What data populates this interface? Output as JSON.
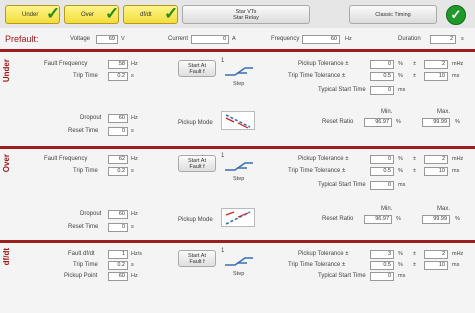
{
  "tabs": {
    "under": "Under",
    "over": "Over",
    "dfdt": "df/dt",
    "starvts": "Star VTs\nStar Relay",
    "classic": "Classic Timing"
  },
  "prefault": {
    "title": "Prefault:",
    "voltage_label": "Voltage",
    "voltage": "69",
    "voltage_unit": "V",
    "current_label": "Current",
    "current": "0",
    "current_unit": "A",
    "frequency_label": "Frequency",
    "frequency": "60",
    "frequency_unit": "Hz",
    "duration_label": "Duration",
    "duration": "2",
    "duration_unit": "s"
  },
  "under": {
    "title": "Under",
    "fault_freq_label": "Fault Frequency",
    "fault_freq": "58",
    "fault_freq_unit": "Hz",
    "trip_time_label": "Trip Time",
    "trip_time": "0.2",
    "trip_time_unit": "s",
    "dropout_label": "Dropout",
    "dropout": "60",
    "dropout_unit": "Hz",
    "reset_time_label": "Reset Time",
    "reset_time": "0",
    "reset_time_unit": "s",
    "start_btn": "Start At\nFault f",
    "ladder_label": "1",
    "ladder_step": "Step",
    "pickup_mode_label": "Pickup Mode",
    "pickup_tol_label": "Pickup Tolerance ±",
    "pickup_tol_pct": "0",
    "pickup_tol_abs": "2",
    "pickup_tol_abs_unit": "mHz",
    "trip_tol_label": "Trip Time Tolerance ±",
    "trip_tol_pct": "0.5",
    "trip_tol_abs": "10",
    "trip_tol_abs_unit": "ms",
    "typ_start_label": "Typical Start Time",
    "typ_start": "0",
    "typ_start_unit": "ms",
    "min_label": "Min.",
    "max_label": "Max.",
    "reset_ratio_label": "Reset Ratio",
    "reset_min": "96.97",
    "reset_max": "99.99"
  },
  "over": {
    "title": "Over",
    "fault_freq_label": "Fault Frequency",
    "fault_freq": "62",
    "fault_freq_unit": "Hz",
    "trip_time_label": "Trip Time",
    "trip_time": "0.2",
    "trip_time_unit": "s",
    "dropout_label": "Dropout",
    "dropout": "60",
    "dropout_unit": "Hz",
    "reset_time_label": "Reset Time",
    "reset_time": "0",
    "reset_time_unit": "s",
    "start_btn": "Start At\nFault f",
    "ladder_label": "1",
    "ladder_step": "Step",
    "pickup_mode_label": "Pickup Mode",
    "pickup_tol_label": "Pickup Tolerance ±",
    "pickup_tol_pct": "0",
    "pickup_tol_abs": "2",
    "pickup_tol_abs_unit": "mHz",
    "trip_tol_label": "Trip Time Tolerance ±",
    "trip_tol_pct": "0.5",
    "trip_tol_abs": "10",
    "trip_tol_abs_unit": "ms",
    "typ_start_label": "Typical Start Time",
    "typ_start": "0",
    "typ_start_unit": "ms",
    "min_label": "Min.",
    "max_label": "Max.",
    "reset_ratio_label": "Reset Ratio",
    "reset_min": "96.97",
    "reset_max": "99.99"
  },
  "dfdt": {
    "title": "df/dt",
    "fault_label": "Fault df/dt",
    "fault": "1",
    "fault_unit": "Hz/s",
    "trip_time_label": "Trip Time",
    "trip_time": "0.2",
    "trip_time_unit": "s",
    "pickup_point_label": "Pickup Point",
    "pickup_point": "60",
    "pickup_point_unit": "Hz",
    "start_btn": "Start At\nFault f",
    "ladder_label": "1",
    "ladder_step": "Step",
    "pickup_tol_label": "Pickup Tolerance ±",
    "pickup_tol_pct": "3",
    "pickup_tol_abs": "2",
    "pickup_tol_abs_unit": "mHz",
    "trip_tol_label": "Trip Time Tolerance ±",
    "trip_tol_pct": "0.5",
    "trip_tol_abs": "10",
    "trip_tol_abs_unit": "ms",
    "typ_start_label": "Typical Start Time",
    "typ_start": "0",
    "typ_start_unit": "ms"
  },
  "common": {
    "pct": "%",
    "pm": "±"
  },
  "colors": {
    "accent_red": "#9e1d1d",
    "tab_yellow": "#f2dd3a",
    "ok_green": "#1f9a2a"
  },
  "icons": [
    "check-icon",
    "ok-check-icon",
    "step-ladder-icon",
    "pickup-mode-icon"
  ]
}
